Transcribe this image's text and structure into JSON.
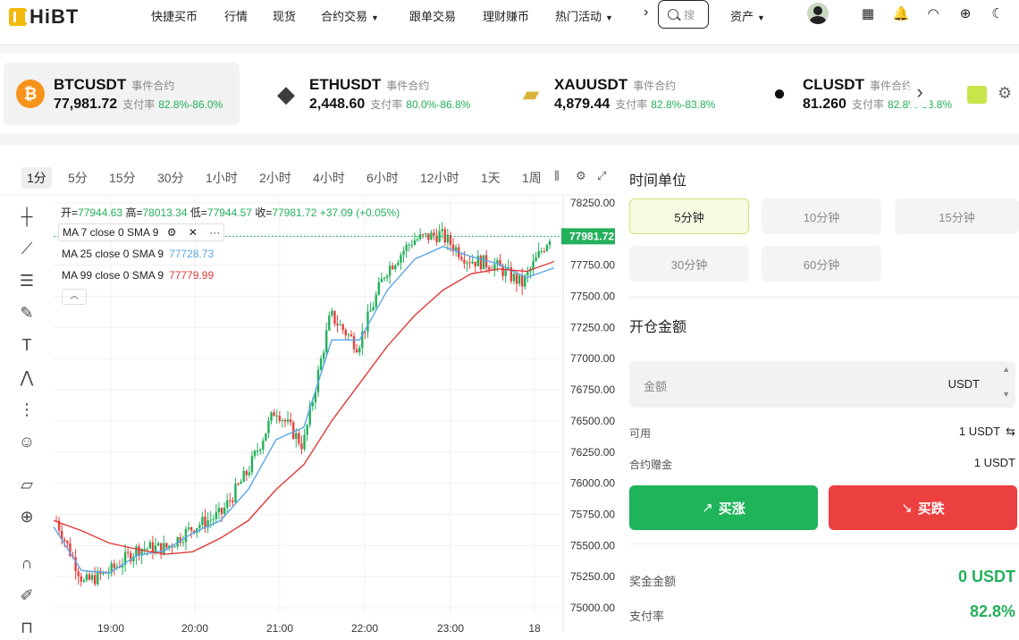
{
  "nav": {
    "logo": "HiBT",
    "items": [
      "快捷买币",
      "行情",
      "现货",
      "合约交易",
      "跟单交易",
      "理财赚币",
      "热门活动"
    ],
    "search_placeholder": "搜",
    "assets": "资产"
  },
  "tickers": [
    {
      "symbol": "BTCUSDT",
      "tag": "事件合约",
      "price": "77,981.72",
      "rate_label": "支付率",
      "rate": "82.8%-86.0%",
      "color": "#f7931a",
      "icon": "bitcoin-icon",
      "glyph": "₿"
    },
    {
      "symbol": "ETHUSDT",
      "tag": "事件合约",
      "price": "2,448.60",
      "rate_label": "支付率",
      "rate": "80.0%-86.8%",
      "color": "#3c3c3d",
      "icon": "ethereum-icon",
      "glyph": "◆"
    },
    {
      "symbol": "XAUUSDT",
      "tag": "事件合约",
      "price": "4,879.44",
      "rate_label": "支付率",
      "rate": "82.8%-83.8%",
      "color": "#d9b33c",
      "icon": "gold-bar-icon",
      "glyph": "▰"
    },
    {
      "symbol": "CLUSDT",
      "tag": "事件合约",
      "price": "81.260",
      "rate_label": "支付率",
      "rate": "82.8%-83.8%",
      "color": "#111111",
      "icon": "oil-drop-icon",
      "glyph": "●"
    }
  ],
  "chart": {
    "timeframes": [
      "1分",
      "5分",
      "15分",
      "30分",
      "1小时",
      "2小时",
      "4小时",
      "6小时",
      "12小时",
      "1天",
      "1周"
    ],
    "active_timeframe": "1分",
    "ohlc": {
      "open_label": "开",
      "open": "77944.63",
      "high_label": "高",
      "high": "78013.34",
      "low_label": "低",
      "low": "77944.57",
      "close_label": "收",
      "close": "77981.72",
      "change": "+37.09 (+0.05%)"
    },
    "ma7": "MA 7 close 0 SMA 9",
    "ma25": "MA 25 close 0 SMA 9",
    "ma25_value": "77728.73",
    "ma99": "MA 99 close 0 SMA 9",
    "ma99_value": "77779.99",
    "current_price": "77981.72",
    "y_ticks": [
      "78250.00",
      "78000.00",
      "77750.00",
      "77500.00",
      "77250.00",
      "77000.00",
      "76750.00",
      "76500.00",
      "76250.00",
      "76000.00",
      "75750.00",
      "75500.00",
      "75250.00",
      "75000.00"
    ],
    "x_ticks": [
      "19:00",
      "20:00",
      "21:00",
      "22:00",
      "23:00",
      "18"
    ]
  },
  "chart_data": {
    "type": "line",
    "title": "",
    "x": [
      "18:00",
      "18:30",
      "19:00",
      "19:30",
      "20:00",
      "20:30",
      "21:00",
      "21:15",
      "21:30",
      "21:45",
      "22:00",
      "22:15",
      "22:30",
      "22:45",
      "23:00",
      "23:15",
      "23:30",
      "23:45",
      "00:00"
    ],
    "series": [
      {
        "name": "BTCUSDT",
        "values": [
          75700,
          75200,
          75300,
          75480,
          75480,
          75650,
          75750,
          76100,
          76600,
          76300,
          77350,
          77100,
          77700,
          77950,
          78000,
          77800,
          77750,
          77600,
          77981.72
        ]
      },
      {
        "name": "MA 25",
        "values": [
          75650,
          75300,
          75280,
          75420,
          75460,
          75600,
          75700,
          75950,
          76350,
          76450,
          77150,
          77150,
          77550,
          77800,
          77900,
          77820,
          77760,
          77650,
          77728.73
        ]
      },
      {
        "name": "MA 99",
        "values": [
          75700,
          75620,
          75520,
          75470,
          75430,
          75450,
          75560,
          75700,
          75950,
          76150,
          76500,
          76800,
          77100,
          77350,
          77550,
          77680,
          77720,
          77700,
          77779.99
        ]
      }
    ],
    "ylim": [
      74950,
      78300
    ],
    "grid": true
  },
  "panel": {
    "time_unit_title": "时间单位",
    "time_units": [
      "5分钟",
      "10分钟",
      "15分钟",
      "30分钟",
      "60分钟"
    ],
    "selected_unit": "5分钟",
    "amount_title": "开仓金额",
    "amount_placeholder": "金额",
    "amount_currency": "USDT",
    "available_label": "可用",
    "available_value": "1 USDT",
    "bonus_label": "合约赠金",
    "bonus_value": "1 USDT",
    "buy_up": "买涨",
    "buy_down": "买跌",
    "reward_label": "奖金金额",
    "reward_value": "0 USDT",
    "rate_label": "支付率",
    "rate_value": "82.8%"
  },
  "colors": {
    "up": "#23b05a",
    "down": "#e8403f",
    "accent": "#c8e64c",
    "ma25": "#5aa6e8",
    "ma99": "#e03a3a"
  }
}
